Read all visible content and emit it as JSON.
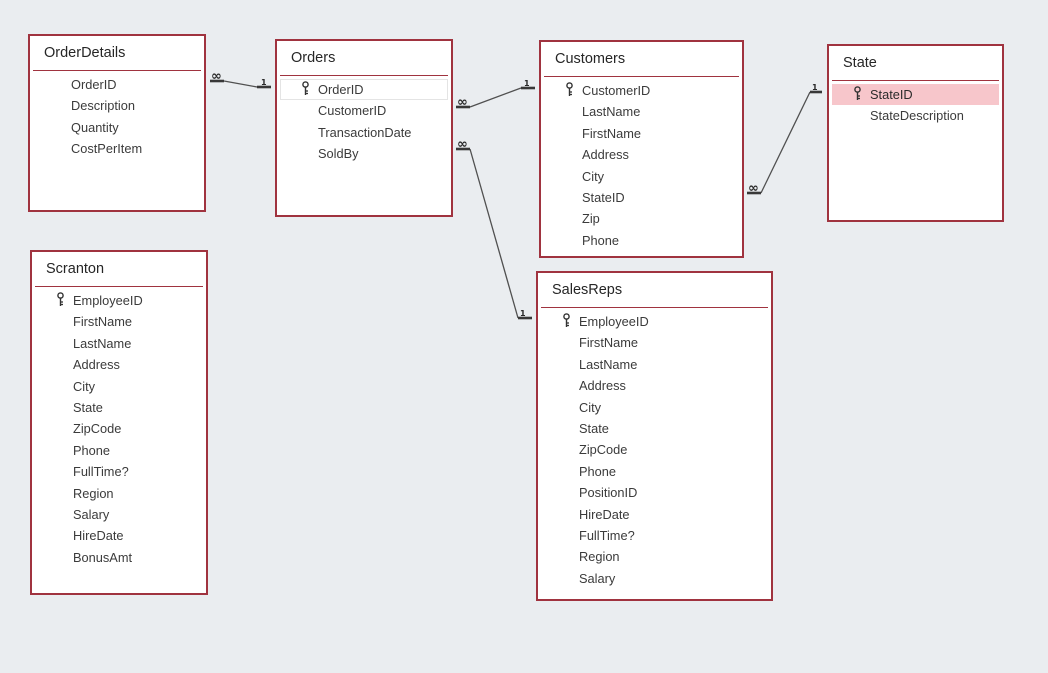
{
  "tables": [
    {
      "id": "orderdetails",
      "title": "OrderDetails",
      "fields": [
        {
          "name": "OrderID",
          "key": false
        },
        {
          "name": "Description",
          "key": false
        },
        {
          "name": "Quantity",
          "key": false
        },
        {
          "name": "CostPerItem",
          "key": false
        }
      ]
    },
    {
      "id": "orders",
      "title": "Orders",
      "fields": [
        {
          "name": "OrderID",
          "key": true,
          "focused": true
        },
        {
          "name": "CustomerID",
          "key": false
        },
        {
          "name": "TransactionDate",
          "key": false
        },
        {
          "name": "SoldBy",
          "key": false
        }
      ]
    },
    {
      "id": "customers",
      "title": "Customers",
      "fields": [
        {
          "name": "CustomerID",
          "key": true
        },
        {
          "name": "LastName",
          "key": false
        },
        {
          "name": "FirstName",
          "key": false
        },
        {
          "name": "Address",
          "key": false
        },
        {
          "name": "City",
          "key": false
        },
        {
          "name": "StateID",
          "key": false
        },
        {
          "name": "Zip",
          "key": false
        },
        {
          "name": "Phone",
          "key": false
        }
      ]
    },
    {
      "id": "state",
      "title": "State",
      "fields": [
        {
          "name": "StateID",
          "key": true,
          "selected": true
        },
        {
          "name": "StateDescription",
          "key": false
        }
      ]
    },
    {
      "id": "scranton",
      "title": "Scranton",
      "fields": [
        {
          "name": "EmployeeID",
          "key": true
        },
        {
          "name": "FirstName",
          "key": false
        },
        {
          "name": "LastName",
          "key": false
        },
        {
          "name": "Address",
          "key": false
        },
        {
          "name": "City",
          "key": false
        },
        {
          "name": "State",
          "key": false
        },
        {
          "name": "ZipCode",
          "key": false
        },
        {
          "name": "Phone",
          "key": false
        },
        {
          "name": "FullTime?",
          "key": false
        },
        {
          "name": "Region",
          "key": false
        },
        {
          "name": "Salary",
          "key": false
        },
        {
          "name": "HireDate",
          "key": false
        },
        {
          "name": "BonusAmt",
          "key": false
        }
      ]
    },
    {
      "id": "salesreps",
      "title": "SalesReps",
      "fields": [
        {
          "name": "EmployeeID",
          "key": true
        },
        {
          "name": "FirstName",
          "key": false
        },
        {
          "name": "LastName",
          "key": false
        },
        {
          "name": "Address",
          "key": false
        },
        {
          "name": "City",
          "key": false
        },
        {
          "name": "State",
          "key": false
        },
        {
          "name": "ZipCode",
          "key": false
        },
        {
          "name": "Phone",
          "key": false
        },
        {
          "name": "PositionID",
          "key": false
        },
        {
          "name": "HireDate",
          "key": false
        },
        {
          "name": "FullTime?",
          "key": false
        },
        {
          "name": "Region",
          "key": false
        },
        {
          "name": "Salary",
          "key": false
        }
      ]
    }
  ],
  "relationships": [
    {
      "from_table": "OrderDetails",
      "from_field": "OrderID",
      "from_label": "∞",
      "to_table": "Orders",
      "to_field": "OrderID",
      "to_label": "1"
    },
    {
      "from_table": "Orders",
      "from_field": "CustomerID",
      "from_label": "∞",
      "to_table": "Customers",
      "to_field": "CustomerID",
      "to_label": "1"
    },
    {
      "from_table": "Orders",
      "from_field": "SoldBy",
      "from_label": "∞",
      "to_table": "SalesReps",
      "to_field": "EmployeeID",
      "to_label": "1"
    },
    {
      "from_table": "Customers",
      "from_field": "StateID",
      "from_label": "∞",
      "to_table": "State",
      "to_field": "StateID",
      "to_label": "1"
    }
  ],
  "colors": {
    "canvas": "#eaedf0",
    "table_border": "#a0333f",
    "selected_row": "#f7c6cb",
    "relationship_line": "#505050"
  }
}
